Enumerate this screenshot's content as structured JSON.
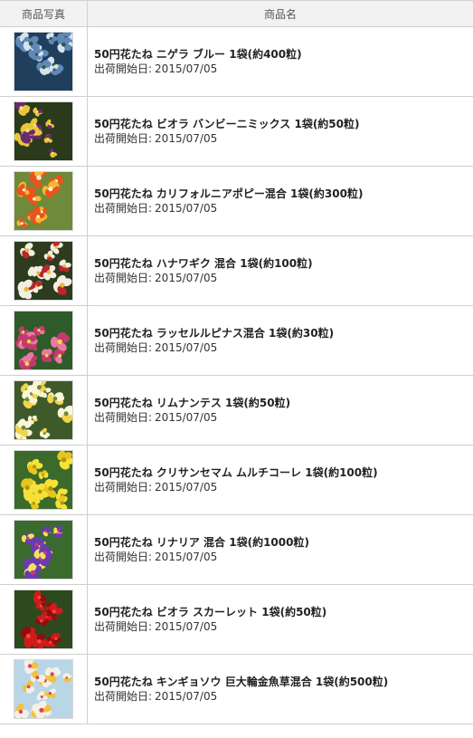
{
  "table": {
    "headers": {
      "photo": "商品写真",
      "name": "商品名"
    },
    "ship_label": "出荷開始日:",
    "products": [
      {
        "name": "50円花たね ニゲラ ブルー 1袋(約400粒)",
        "ship_date": "2015/07/05",
        "photo_icon": "nigella-blue-flower-photo",
        "colors": [
          "#1f3f5c",
          "#5e88b8",
          "#d6e2ef",
          "#2f5a34"
        ]
      },
      {
        "name": "50円花たね ビオラ バンビーニミックス 1袋(約50粒)",
        "ship_date": "2015/07/05",
        "photo_icon": "viola-bambini-mix-flower-photo",
        "colors": [
          "#2b3a1a",
          "#e9c53a",
          "#6a2a6e",
          "#f4e08a"
        ]
      },
      {
        "name": "50円花たね カリフォルニアポピー混合 1袋(約300粒)",
        "ship_date": "2015/07/05",
        "photo_icon": "california-poppy-flower-photo",
        "colors": [
          "#6e8a3a",
          "#e8541d",
          "#f7b733",
          "#f7f0d2"
        ]
      },
      {
        "name": "50円花たね ハナワギク 混合 1袋(約100粒)",
        "ship_date": "2015/07/05",
        "photo_icon": "hanawagiku-flower-photo",
        "colors": [
          "#2d3b1e",
          "#f2efe2",
          "#b8272d",
          "#e6b939"
        ]
      },
      {
        "name": "50円花たね ラッセルルピナス混合 1袋(約30粒)",
        "ship_date": "2015/07/05",
        "photo_icon": "russell-lupin-flower-photo",
        "colors": [
          "#2f5a2a",
          "#c23a6e",
          "#e77aa0",
          "#f2d34a"
        ]
      },
      {
        "name": "50円花たね リムナンテス 1袋(約50粒)",
        "ship_date": "2015/07/05",
        "photo_icon": "limnanthes-flower-photo",
        "colors": [
          "#3f5a2a",
          "#fbf6d8",
          "#f1d44a",
          "#6a8a3c"
        ]
      },
      {
        "name": "50円花たね クリサンセマム ムルチコーレ 1袋(約100粒)",
        "ship_date": "2015/07/05",
        "photo_icon": "chrysanthemum-multicaule-flower-photo",
        "colors": [
          "#3b6a2a",
          "#f6e13a",
          "#e8c41f",
          "#a89614"
        ]
      },
      {
        "name": "50円花たね リナリア 混合 1袋(約1000粒)",
        "ship_date": "2015/07/05",
        "photo_icon": "linaria-flower-photo",
        "colors": [
          "#3b6a2f",
          "#6a3ab0",
          "#f4e060",
          "#c43e7a"
        ]
      },
      {
        "name": "50円花たね ビオラ スカーレット 1袋(約50粒)",
        "ship_date": "2015/07/05",
        "photo_icon": "viola-scarlet-flower-photo",
        "colors": [
          "#2d4a1e",
          "#d21a1a",
          "#8f0e10",
          "#f24a3a"
        ]
      },
      {
        "name": "50円花たね キンギョソウ 巨大輪金魚草混合 1袋(約500粒)",
        "ship_date": "2015/07/05",
        "photo_icon": "snapdragon-flower-photo",
        "colors": [
          "#b9d6e6",
          "#f4f0e6",
          "#f2c23a",
          "#d8485a"
        ]
      }
    ]
  }
}
